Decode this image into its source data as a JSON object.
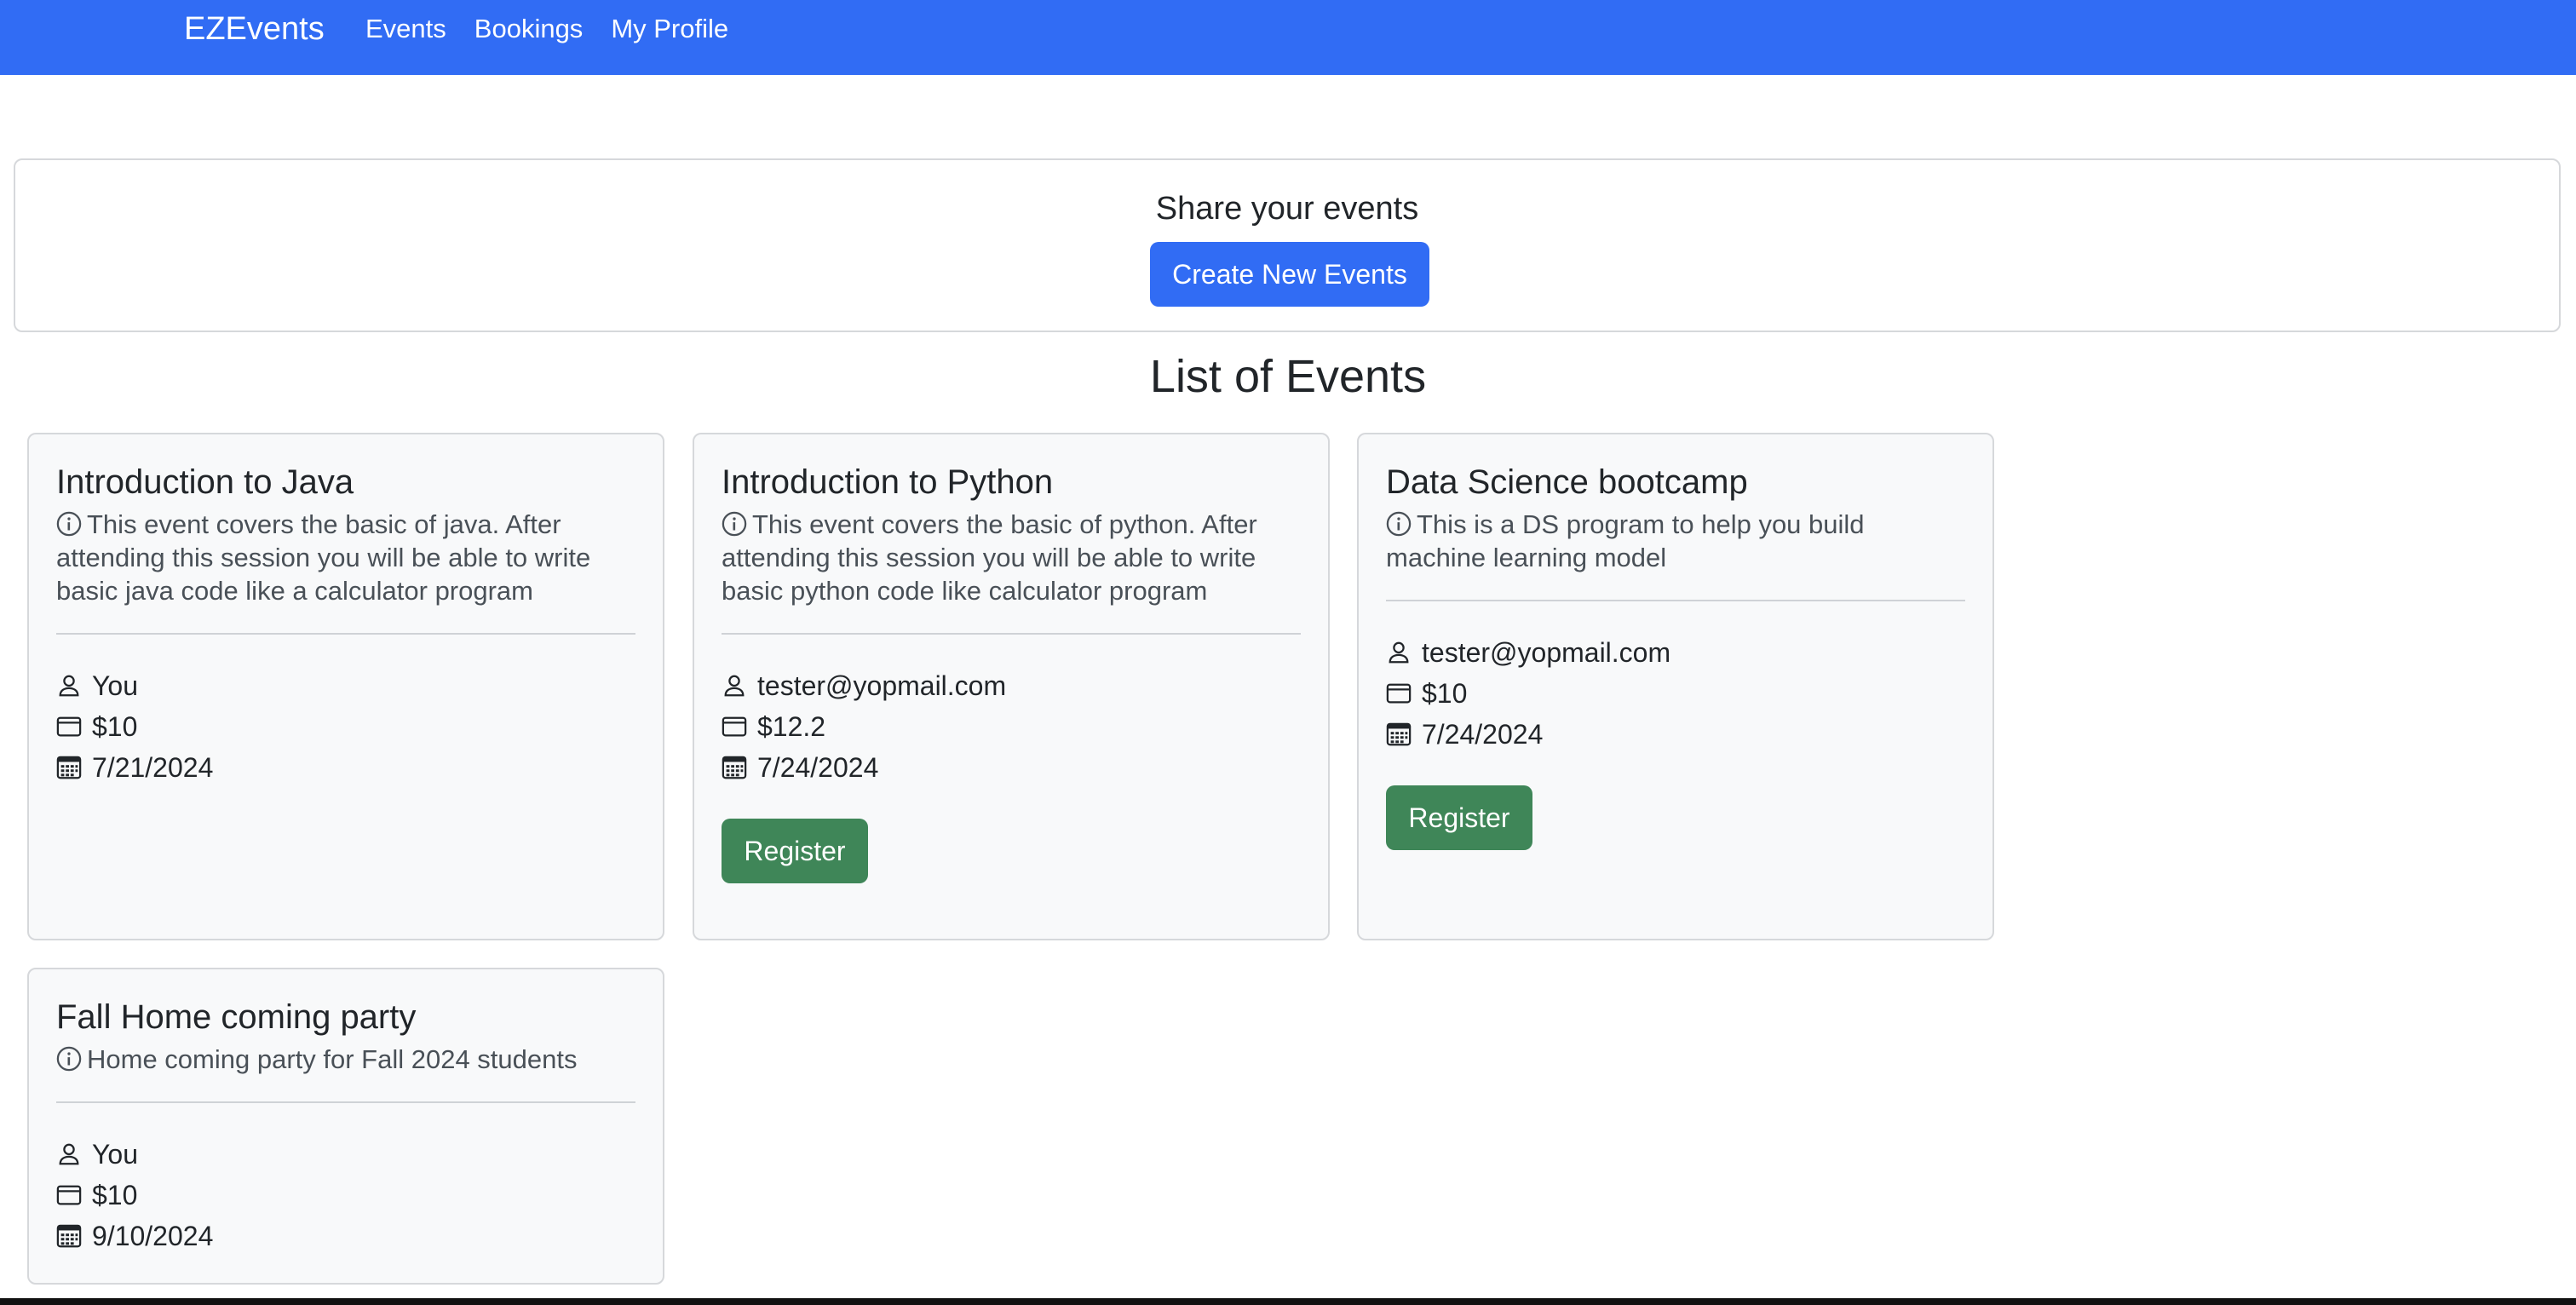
{
  "nav": {
    "brand": "EZEvents",
    "links": [
      "Events",
      "Bookings",
      "My Profile"
    ]
  },
  "share": {
    "title": "Share your events",
    "button_label": "Create New Events"
  },
  "list_title": "List of Events",
  "events": [
    {
      "title": "Introduction to Java",
      "description": "This event covers the basic of java. After attending this session you will be able to write basic java code like a calculator program",
      "organizer": "You",
      "price": "$10",
      "date": "7/21/2024",
      "register_label": ""
    },
    {
      "title": "Introduction to Python",
      "description": "This event covers the basic of python. After attending this session you will be able to write basic python code like calculator program",
      "organizer": "tester@yopmail.com",
      "price": "$12.2",
      "date": "7/24/2024",
      "register_label": "Register"
    },
    {
      "title": "Data Science bootcamp",
      "description": "This is a DS program to help you build machine learning model",
      "organizer": "tester@yopmail.com",
      "price": "$10",
      "date": "7/24/2024",
      "register_label": "Register"
    },
    {
      "title": "Fall Home coming party",
      "description": "Home coming party for Fall 2024 students",
      "organizer": "You",
      "price": "$10",
      "date": "9/10/2024",
      "register_label": ""
    }
  ],
  "colors": {
    "navbar": "#316cf4",
    "primary_button": "#316cf4",
    "register_button": "#3f8658",
    "card_background": "#f8f9fa"
  }
}
